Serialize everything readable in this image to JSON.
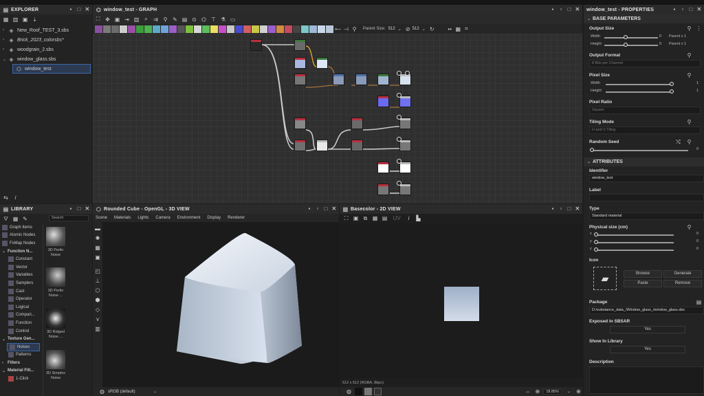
{
  "explorer": {
    "title": "EXPLORER",
    "files": [
      {
        "label": "New_Roof_TEST_3.sbs",
        "italic": false
      },
      {
        "label": "Brick_2023_colorsbs*",
        "italic": true
      },
      {
        "label": "woodgrain_2.sbs",
        "italic": false
      },
      {
        "label": "window_glass.sbs",
        "italic": false
      }
    ],
    "selected_graph": "window_test"
  },
  "graph": {
    "title": "window_test - GRAPH",
    "parent_size_label": "Parent Size:",
    "parent_size_value": "512",
    "size_value": "512"
  },
  "library": {
    "title": "LIBRARY",
    "search_placeholder": "Search",
    "items": [
      {
        "label": "Graph Items",
        "type": "cat"
      },
      {
        "label": "Atomic Nodes",
        "type": "cat"
      },
      {
        "label": "FxMap Nodes",
        "type": "cat"
      },
      {
        "label": "Function N...",
        "type": "group"
      },
      {
        "label": "Constant",
        "type": "sub"
      },
      {
        "label": "Vector",
        "type": "sub"
      },
      {
        "label": "Variables",
        "type": "sub"
      },
      {
        "label": "Samplers",
        "type": "sub"
      },
      {
        "label": "Cast",
        "type": "sub"
      },
      {
        "label": "Operator",
        "type": "sub"
      },
      {
        "label": "Logical",
        "type": "sub"
      },
      {
        "label": "Compari...",
        "type": "sub"
      },
      {
        "label": "Function",
        "type": "sub"
      },
      {
        "label": "Control",
        "type": "sub"
      },
      {
        "label": "Texture Gen...",
        "type": "group"
      },
      {
        "label": "Noises",
        "type": "sub-selected"
      },
      {
        "label": "Patterns",
        "type": "sub"
      },
      {
        "label": "Filters",
        "type": "group"
      },
      {
        "label": "Material Filt...",
        "type": "group"
      },
      {
        "label": "1-Click",
        "type": "sub"
      }
    ],
    "thumbs": [
      {
        "line1": "3D Perlin",
        "line2": "Noise"
      },
      {
        "line1": "3D Perlin",
        "line2": "Noise ..."
      },
      {
        "line1": "3D Ridged",
        "line2": "Noise ..."
      },
      {
        "line1": "3D Simplex",
        "line2": "Noise"
      }
    ]
  },
  "view3d": {
    "title": "Rounded Cube - OpenGL - 3D VIEW",
    "menu": [
      "Scene",
      "Materials",
      "Lights",
      "Camera",
      "Environment",
      "Display",
      "Renderer"
    ],
    "colorspace": "sRGB (default)"
  },
  "view2d": {
    "title": "Basecolor - 2D VIEW",
    "info": "512 x 512 (RGBA, 8bpc)",
    "zoom": "18.85%"
  },
  "properties": {
    "title": "window_test - PROPERTIES",
    "base_section": "BASE PARAMETERS",
    "output_size": {
      "label": "Output Size",
      "width_label": "Width",
      "height_label": "Height",
      "width_value": "0",
      "height_value": "0",
      "width_parent": "Parent x 1",
      "height_parent": "Parent x 1",
      "width_fraction": 0.4,
      "height_fraction": 0.4
    },
    "output_format": {
      "label": "Output Format",
      "value": "8 Bits per Channel"
    },
    "pixel_size": {
      "label": "Pixel Size",
      "width_label": "Width",
      "height_label": "Height",
      "width_value": "1",
      "height_value": "1"
    },
    "pixel_ratio": {
      "label": "Pixel Ratio",
      "value": "Square"
    },
    "tiling_mode": {
      "label": "Tiling Mode",
      "value": "H and V Tiling"
    },
    "random_seed": {
      "label": "Random Seed",
      "value": "0"
    },
    "attr_section": "ATTRIBUTES",
    "identifier": {
      "label": "Identifier",
      "value": "window_test"
    },
    "label": {
      "label": "Label",
      "value": ""
    },
    "type": {
      "label": "Type",
      "value": "Standard material"
    },
    "physical_size": {
      "label": "Physical size (cm)",
      "axes": [
        "x",
        "y",
        "z"
      ],
      "values": [
        "0",
        "0",
        "0"
      ]
    },
    "icon": {
      "label": "Icon",
      "browse": "Browse",
      "generate": "Generate",
      "paste": "Paste",
      "remove": "Remove"
    },
    "package": {
      "label": "Package",
      "value": "D:/substance_data_/Window_glass_/window_glass.sbs"
    },
    "exposed": {
      "label": "Exposed in SBSAR",
      "value": "Yes"
    },
    "show_library": {
      "label": "Show In Library",
      "value": "Yes"
    },
    "description": {
      "label": "Description"
    }
  }
}
